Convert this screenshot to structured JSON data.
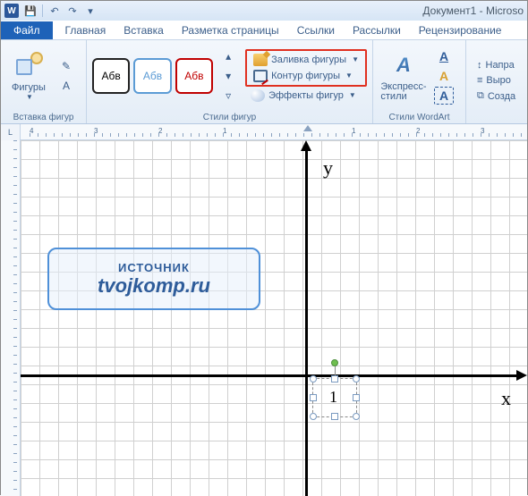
{
  "title": "Документ1 - Microso",
  "qat": {
    "save": "💾",
    "undo": "↶",
    "redo": "↷"
  },
  "tabs": {
    "file": "Файл",
    "items": [
      "Главная",
      "Вставка",
      "Разметка страницы",
      "Ссылки",
      "Рассылки",
      "Рецензирование"
    ]
  },
  "ribbon": {
    "insert_shapes": {
      "label": "Фигуры",
      "group": "Вставка фигур"
    },
    "shape_styles": {
      "group": "Стили фигур",
      "sample": "Абв",
      "fill": "Заливка фигуры",
      "outline": "Контур фигуры",
      "effects": "Эффекты фигур"
    },
    "wordart": {
      "label": "Экспресс-\nстили",
      "group": "Стили WordArt"
    },
    "right": {
      "direction": "Напра",
      "align": "Выро",
      "create": "Созда"
    }
  },
  "ruler": {
    "nums": [
      "4",
      "3",
      "2",
      "1",
      "",
      "1",
      "2",
      "3"
    ]
  },
  "axes": {
    "x": "x",
    "y": "y",
    "unit": "1"
  },
  "watermark": {
    "line1": "ИСТОЧНИК",
    "line2": "tvojkomp.ru"
  }
}
